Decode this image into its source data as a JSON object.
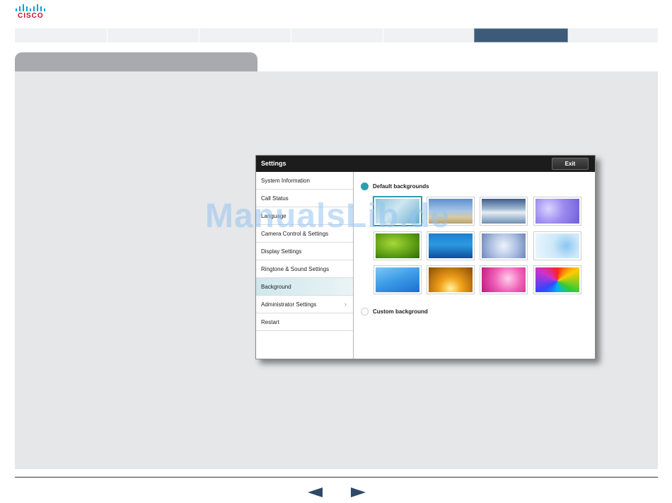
{
  "logo": {
    "text": "CISCO",
    "color": "#c8102e",
    "bar_color": "#049fd9"
  },
  "settings_window": {
    "title": "Settings",
    "exit_label": "Exit",
    "menu_items": [
      {
        "label": "System Information",
        "active": false
      },
      {
        "label": "Call Status",
        "active": false
      },
      {
        "label": "Language",
        "active": false
      },
      {
        "label": "Camera Control & Settings",
        "active": false
      },
      {
        "label": "Display Settings",
        "active": false
      },
      {
        "label": "Ringtone & Sound Settings",
        "active": false
      },
      {
        "label": "Background",
        "active": true
      },
      {
        "label": "Administrator Settings",
        "active": false,
        "has_submenu": true
      },
      {
        "label": "Restart",
        "active": false
      }
    ],
    "default_backgrounds_label": "Default backgrounds",
    "custom_background_label": "Custom background",
    "selected_option": "Default backgrounds",
    "thumbnails": [
      {
        "name": "sky-blue",
        "selected": true
      },
      {
        "name": "beach"
      },
      {
        "name": "clouds-sea"
      },
      {
        "name": "purple-drops"
      },
      {
        "name": "green-abstract"
      },
      {
        "name": "blue-ocean"
      },
      {
        "name": "snow-crystals"
      },
      {
        "name": "light-blue-circles"
      },
      {
        "name": "blue-lines"
      },
      {
        "name": "orange-glow"
      },
      {
        "name": "pink-swirl"
      },
      {
        "name": "rainbow-burst"
      }
    ]
  },
  "watermark": "ManualsLib.de",
  "colors": {
    "accent": "#2b9fae",
    "nav_active": "#3d5b78",
    "arrow": "#2e4a68"
  }
}
